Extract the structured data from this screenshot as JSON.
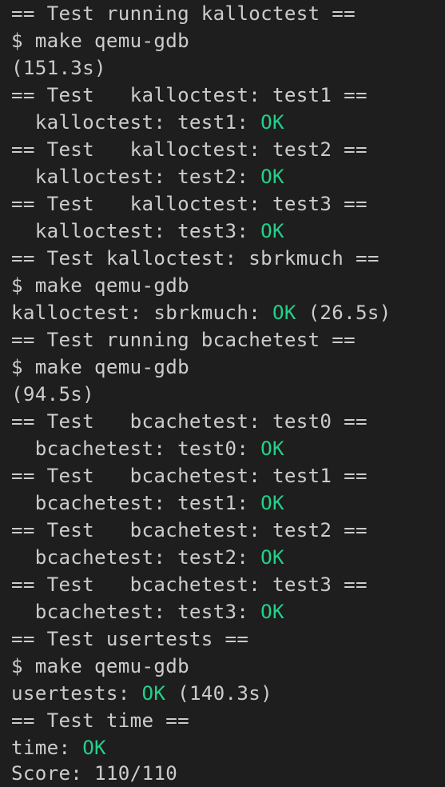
{
  "colors": {
    "background": "#1e1e1e",
    "text": "#cccccc",
    "ok": "#23d18b"
  },
  "lines": [
    {
      "pre": "== Test running kalloctest ==",
      "ok": "",
      "post": ""
    },
    {
      "pre": "$ make qemu-gdb",
      "ok": "",
      "post": ""
    },
    {
      "pre": "(151.3s)",
      "ok": "",
      "post": ""
    },
    {
      "pre": "== Test   kalloctest: test1 ==",
      "ok": "",
      "post": ""
    },
    {
      "pre": "  kalloctest: test1: ",
      "ok": "OK",
      "post": ""
    },
    {
      "pre": "== Test   kalloctest: test2 ==",
      "ok": "",
      "post": ""
    },
    {
      "pre": "  kalloctest: test2: ",
      "ok": "OK",
      "post": ""
    },
    {
      "pre": "== Test   kalloctest: test3 ==",
      "ok": "",
      "post": ""
    },
    {
      "pre": "  kalloctest: test3: ",
      "ok": "OK",
      "post": ""
    },
    {
      "pre": "== Test kalloctest: sbrkmuch ==",
      "ok": "",
      "post": ""
    },
    {
      "pre": "$ make qemu-gdb",
      "ok": "",
      "post": ""
    },
    {
      "pre": "kalloctest: sbrkmuch: ",
      "ok": "OK",
      "post": " (26.5s)"
    },
    {
      "pre": "== Test running bcachetest ==",
      "ok": "",
      "post": ""
    },
    {
      "pre": "$ make qemu-gdb",
      "ok": "",
      "post": ""
    },
    {
      "pre": "(94.5s)",
      "ok": "",
      "post": ""
    },
    {
      "pre": "== Test   bcachetest: test0 ==",
      "ok": "",
      "post": ""
    },
    {
      "pre": "  bcachetest: test0: ",
      "ok": "OK",
      "post": ""
    },
    {
      "pre": "== Test   bcachetest: test1 ==",
      "ok": "",
      "post": ""
    },
    {
      "pre": "  bcachetest: test1: ",
      "ok": "OK",
      "post": ""
    },
    {
      "pre": "== Test   bcachetest: test2 ==",
      "ok": "",
      "post": ""
    },
    {
      "pre": "  bcachetest: test2: ",
      "ok": "OK",
      "post": ""
    },
    {
      "pre": "== Test   bcachetest: test3 ==",
      "ok": "",
      "post": ""
    },
    {
      "pre": "  bcachetest: test3: ",
      "ok": "OK",
      "post": ""
    },
    {
      "pre": "== Test usertests ==",
      "ok": "",
      "post": ""
    },
    {
      "pre": "$ make qemu-gdb",
      "ok": "",
      "post": ""
    },
    {
      "pre": "usertests: ",
      "ok": "OK",
      "post": " (140.3s)"
    },
    {
      "pre": "== Test time ==",
      "ok": "",
      "post": ""
    },
    {
      "pre": "time: ",
      "ok": "OK",
      "post": ""
    },
    {
      "pre": "Score: 110/110",
      "ok": "",
      "post": ""
    }
  ]
}
